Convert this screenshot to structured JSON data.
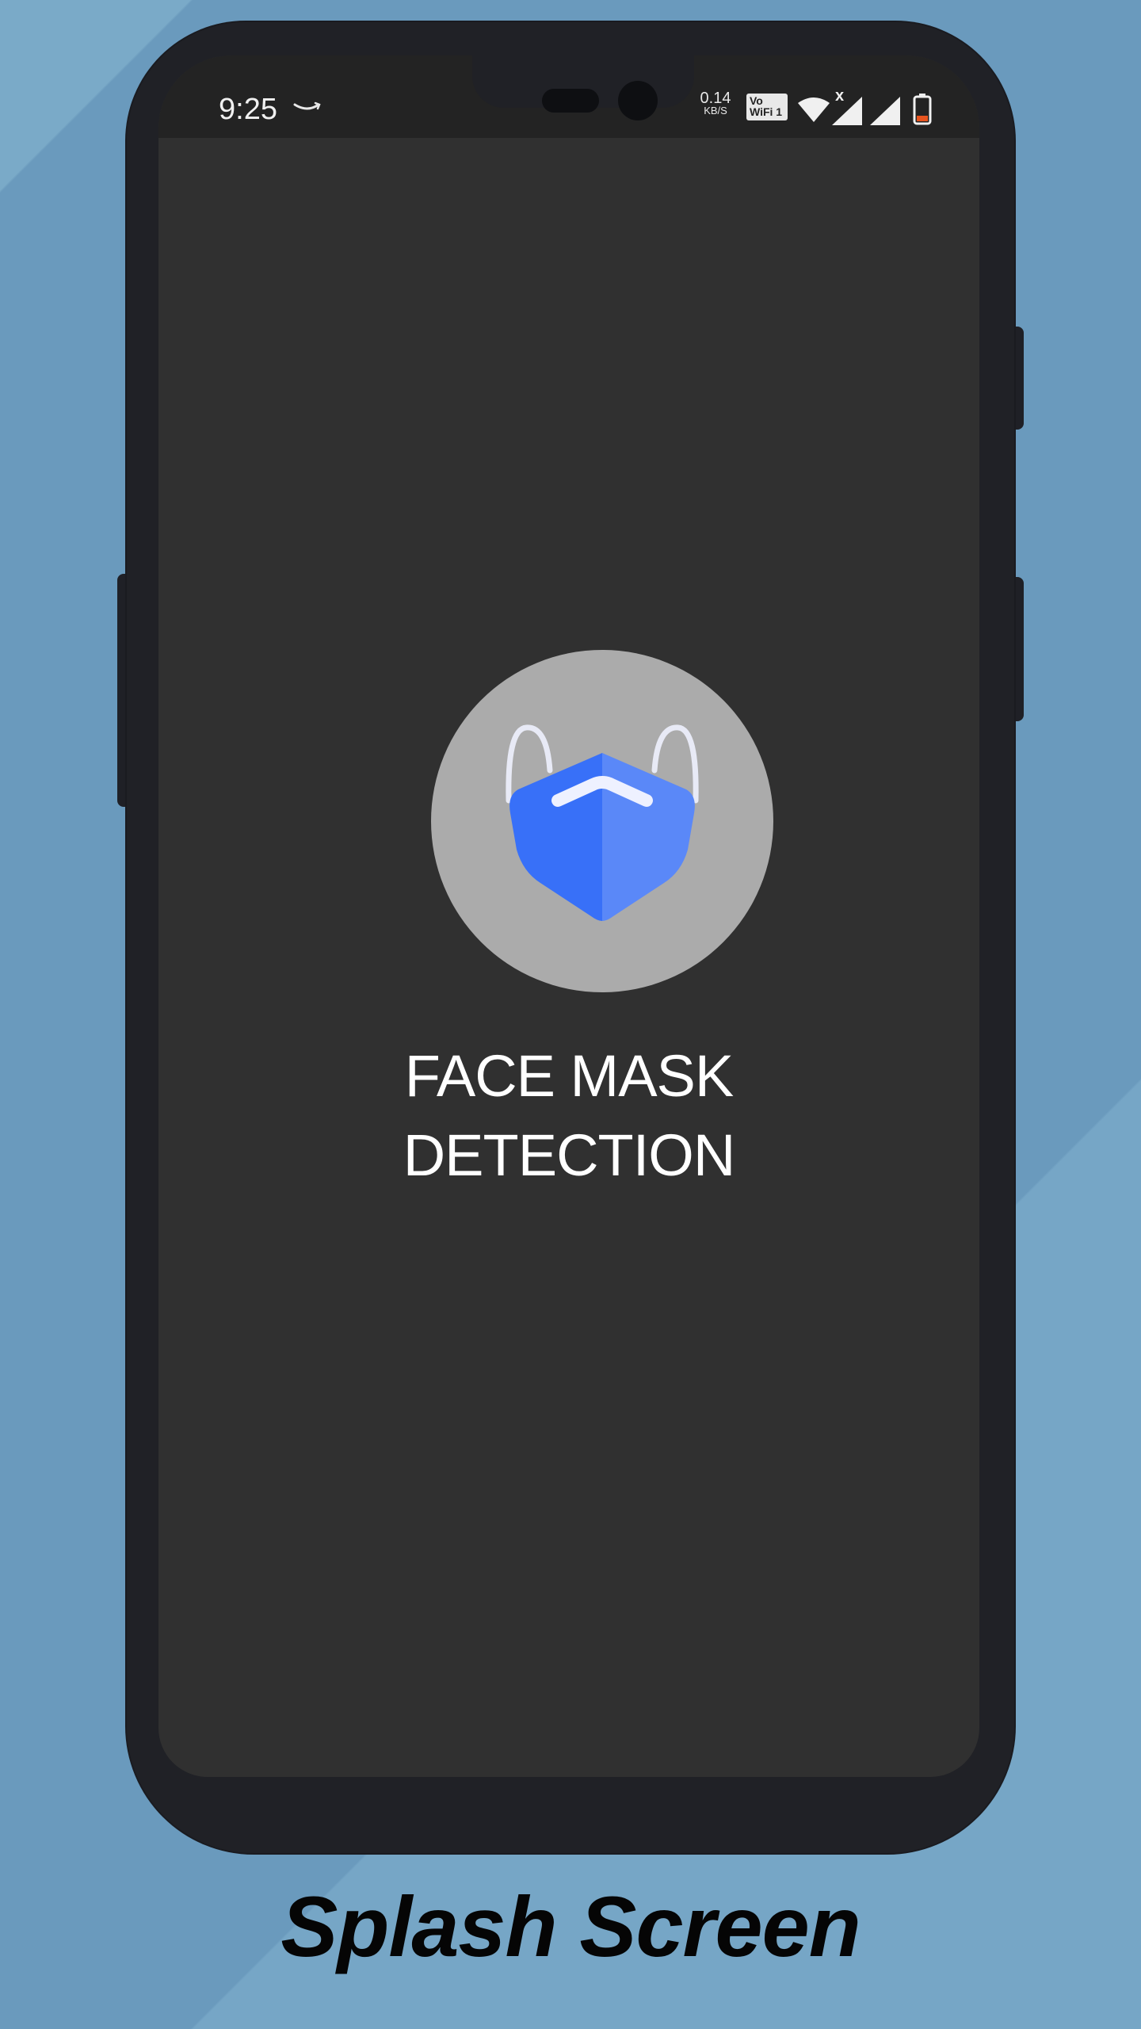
{
  "status_bar": {
    "time": "9:25",
    "data_rate_value": "0.14",
    "data_rate_unit": "KB/S",
    "vowifi_top": "Vo",
    "vowifi_bottom": "WiFi 1",
    "signal_x": "x",
    "icons": [
      "amazon-smile-icon",
      "vowifi-icon",
      "wifi-icon",
      "cell-signal-icon",
      "cell-signal-icon",
      "battery-icon"
    ]
  },
  "splash": {
    "title_line1": "FACE MASK",
    "title_line2": "DETECTION",
    "logo_icon": "face-mask-icon",
    "colors": {
      "screen_bg": "#303030",
      "logo_circle": "#ababab",
      "mask_primary": "#3870f8",
      "mask_secondary": "#5a88f8",
      "straps": "#e8eaf6"
    }
  },
  "caption": "Splash Screen",
  "colors": {
    "background": "#6a9abd",
    "phone_body": "#202126"
  }
}
